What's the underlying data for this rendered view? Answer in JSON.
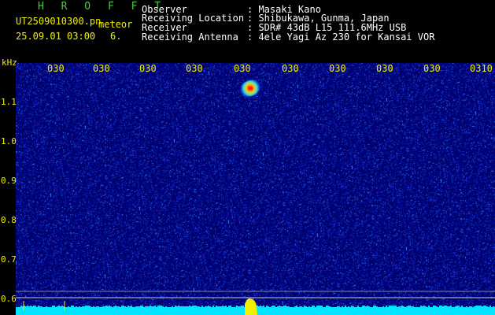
{
  "header": {
    "program": "H R O F F T",
    "file_prefix": "UT2509010300.pn",
    "mode": "meteor",
    "datetime": "25.09.01 03:00",
    "count": "6.",
    "observer_label": "Observer",
    "observer_value": ": Masaki Kano",
    "location_label": "Receiving Location",
    "location_value": ": Shibukawa, Gunma, Japan",
    "receiver_label": "Receiver",
    "receiver_value": ": SDR# 43dB L15 111.6MHz USB",
    "antenna_label": "Receiving Antenna",
    "antenna_value": ": 4ele Yagi Az 230 for Kansai VOR"
  },
  "spectrogram": {
    "unit_label": "kHz",
    "y_ticks": [
      "1.1",
      "1.0",
      "0.9",
      "0.8",
      "0.7",
      "0.6"
    ],
    "time_ticks": [
      "030",
      "030",
      "030",
      "030",
      "030",
      "030",
      "030",
      "030",
      "030",
      "0310"
    ],
    "colors": {
      "background": "#00006e",
      "noise": "#3a5cff",
      "level_bar": "#00e5ff",
      "meteor": "#ff2a2a",
      "spike": "#f0f000",
      "text": "#f0f000"
    },
    "meteor_echo_count": 1
  }
}
